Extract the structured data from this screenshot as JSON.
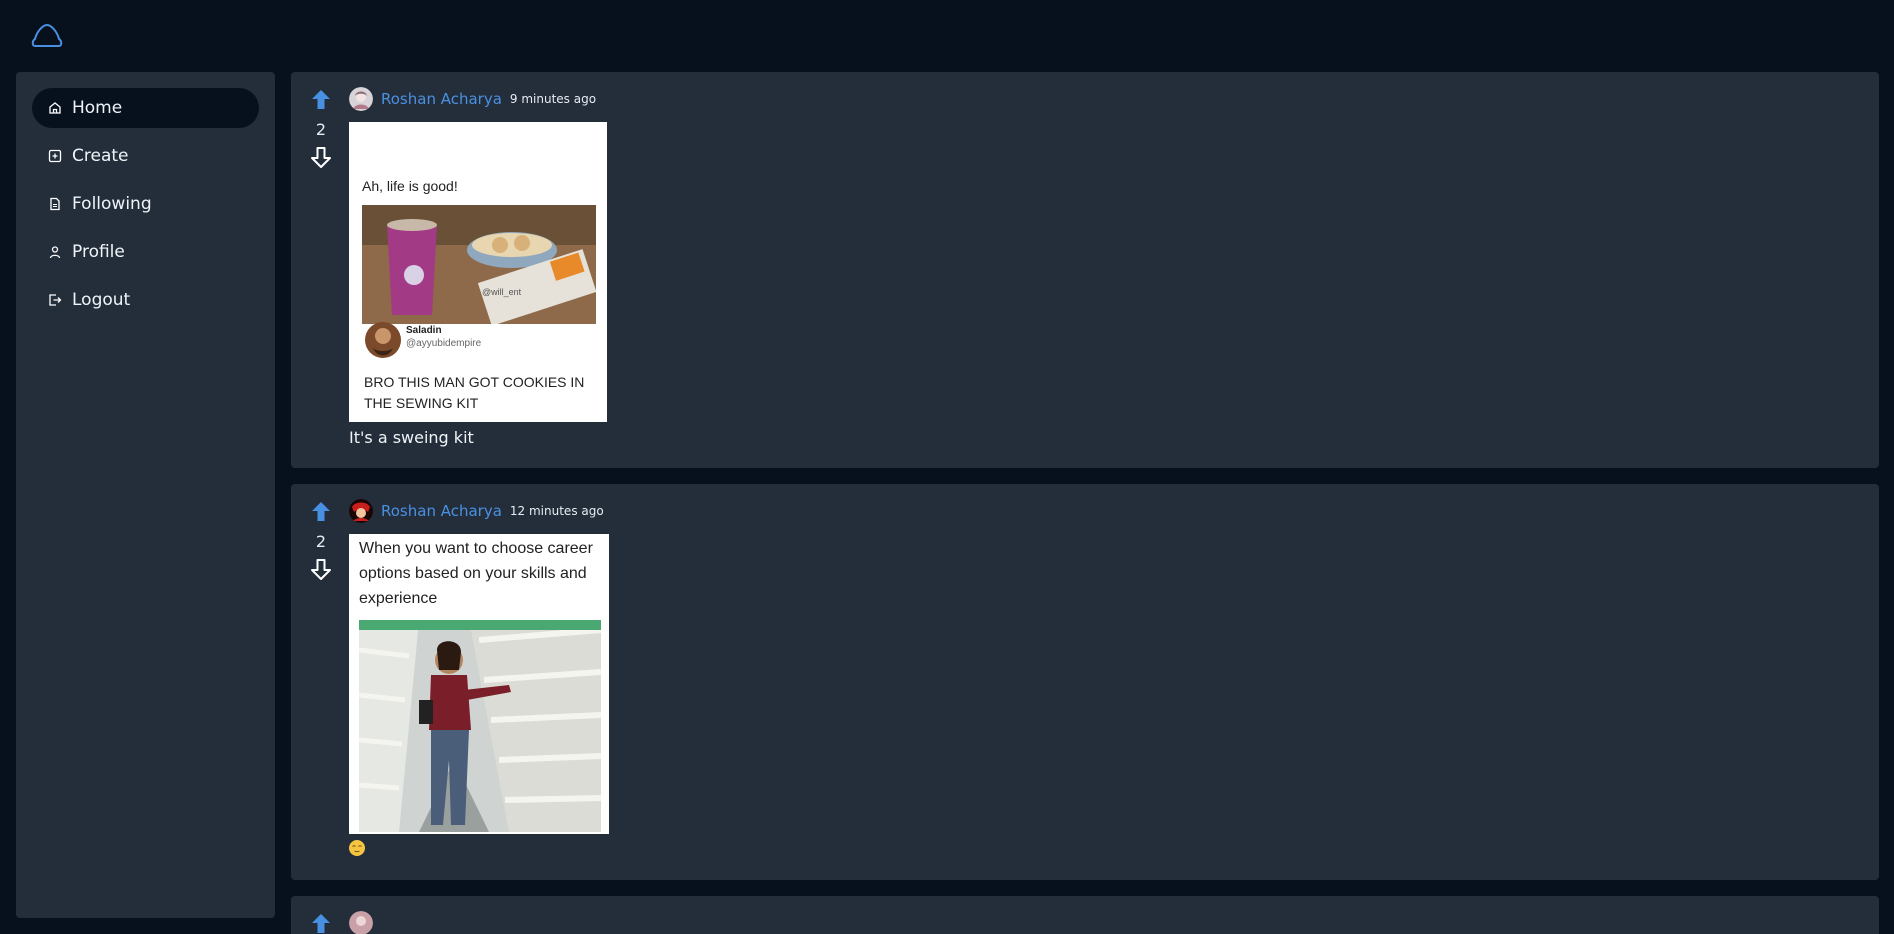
{
  "nav": {
    "items": [
      {
        "label": "Home",
        "icon": "home-icon",
        "active": true
      },
      {
        "label": "Create",
        "icon": "plus-square-icon"
      },
      {
        "label": "Following",
        "icon": "file-icon"
      },
      {
        "label": "Profile",
        "icon": "user-icon"
      },
      {
        "label": "Logout",
        "icon": "logout-icon"
      }
    ]
  },
  "posts": [
    {
      "author": "Roshan Acharya",
      "time": "9 minutes ago",
      "votes": "2",
      "meme": {
        "headline": "Ah, life is good!",
        "watermark": "@will_ent",
        "tweet_name": "Saladin",
        "tweet_handle": "@ayyubidempire",
        "tweet_text": "BRO THIS MAN GOT COOKIES IN THE SEWING KIT"
      },
      "caption": "It's a sweing kit"
    },
    {
      "author": "Roshan Acharya",
      "time": "12 minutes ago",
      "votes": "2",
      "meme": {
        "headline": "When you want to choose career options based on your skills and experience"
      },
      "caption_emoji": "relieved-face-emoji"
    }
  ],
  "colors": {
    "accent": "#4a90e2",
    "background": "#07111d",
    "panel": "#232e3a"
  }
}
